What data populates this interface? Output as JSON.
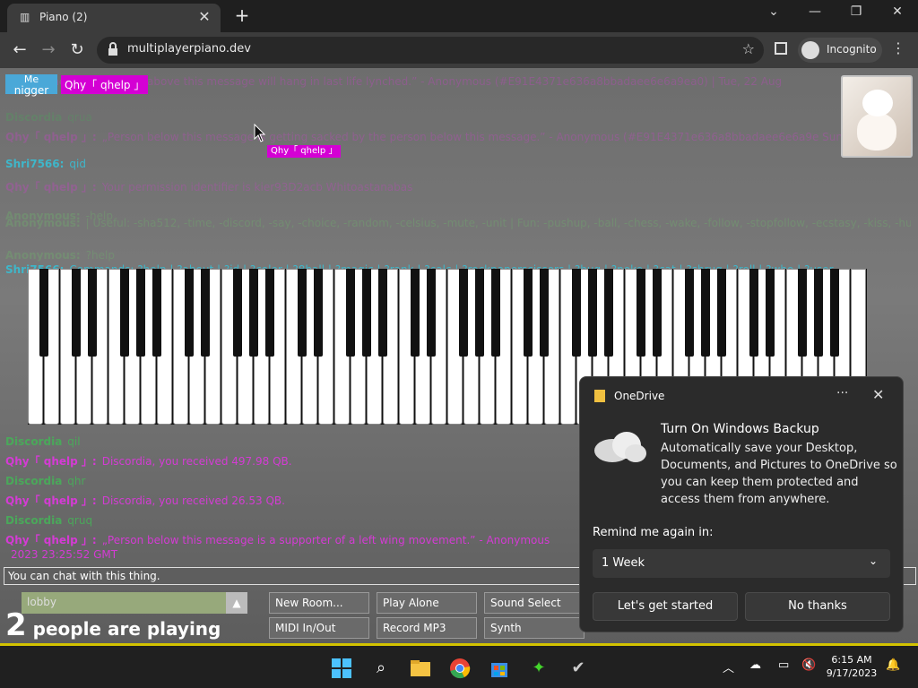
{
  "browser": {
    "tab_title": "Piano (2)",
    "url": "multiplayerpiano.dev",
    "incognito_label": "Incognito"
  },
  "overlay": {
    "badge_me": "Me",
    "badge_user": "nigger",
    "badge_qhy": "Qhy「 qhelp 」",
    "cursor_tag": "Qhy「 qhelp 」"
  },
  "chat": [
    {
      "name": "Qhy「 qhelp 」:",
      "text": "„Person above this message will hang in last life lynched.” - Anonymous (#E91E4371e636a8bbadaee6e6a9ea0) | Tue, 22 Aug",
      "color": "#d43bd4",
      "dim": true
    },
    {
      "name": "Discordia",
      "text": "qrua",
      "color": "#4aa85a",
      "dim": true
    },
    {
      "name": "Qhy「 qhelp 」:",
      "text": "„Person below this message is getting sacked by the person below this message.” - Anonymous (#E91E4371e636a8bbadaee6e6a9e Sun, 03 Sep 2023 14:35:41 GMT",
      "color": "#d43bd4",
      "dim": true
    },
    {
      "name": "Shri7566:",
      "text": "qid",
      "color": "#3fb6c9",
      "dim": false
    },
    {
      "name": "Qhy「 qhelp 」:",
      "text": "Your permission identifier is kier93D2acb Whitoastanabas",
      "color": "#d43bd4",
      "dim": true
    },
    {
      "name": "Anonymous:",
      "text": "-help",
      "color": "#6dbf6a",
      "dim": true
    },
    {
      "name": "Anonymous:",
      "text": "| Useful: -sha512, -time, -discord, -say, -choice, -random, -celsius, -mute, -unit | Fun: -pushup, -ball, -chess, -wake, -follow, -stopfollow, -ecstasy, -kiss, -hug, -cuddle, -8b, -dog, -aknkb, -poke, -lpm, -slap, -punch, -snipe, -wtf",
      "color": "#6dbf6a",
      "dim": true
    },
    {
      "name": "Anonymous:",
      "text": "?help",
      "color": "#6dbf6a",
      "dim": true
    },
    {
      "name": "Shri7566:",
      "text": "Commands: ?help | ?about | ?id | ?color | ?8ball | ?magic | ?rank | ?calc | ?rockpaperscissors | ?hug | ?poke | ?cat | ?shrug | ?roll | ?who | ?user",
      "color": "#3fb6c9",
      "dim": false
    },
    {
      "name": "Discordia",
      "text": "qil",
      "color": "#4aa85a",
      "dim": false
    },
    {
      "name": "Qhy「 qhelp 」:",
      "text": "Discordia, you received 497.98 QB.",
      "color": "#d43bd4",
      "dim": false
    },
    {
      "name": "Discordia",
      "text": "qhr",
      "color": "#4aa85a",
      "dim": false
    },
    {
      "name": "Qhy「 qhelp 」:",
      "text": "Discordia, you received 26.53 QB.",
      "color": "#d43bd4",
      "dim": false
    },
    {
      "name": "Discordia",
      "text": "qruq",
      "color": "#4aa85a",
      "dim": false
    },
    {
      "name": "Qhy「 qhelp 」:",
      "text": "„Person below this message is a supporter of a left wing movement.” - Anonymous",
      "color": "#d43bd4",
      "dim": false
    },
    {
      "name": "",
      "text": "2023 23:25:52 GMT",
      "color": "#d43bd4",
      "dim": false
    }
  ],
  "chat_input": {
    "placeholder": "You can chat with this thing."
  },
  "room": {
    "name": "lobby",
    "arrow": "▲",
    "count": "2",
    "count_label": "people are playing"
  },
  "buttons": {
    "new_room": "New Room...",
    "play_alone": "Play Alone",
    "sound_select": "Sound Select",
    "midi": "MIDI In/Out",
    "record": "Record MP3",
    "synth": "Synth"
  },
  "onedrive": {
    "app": "OneDrive",
    "more": "···",
    "close": "✕",
    "heading": "Turn On Windows Backup",
    "body": "Automatically save your Desktop, Documents, and Pictures to OneDrive so you can keep them protected and access them from anywhere.",
    "remind_label": "Remind me again in:",
    "remind_value": "1 Week",
    "primary": "Let's get started",
    "secondary": "No thanks"
  },
  "taskbar": {
    "time": "6:15 AM",
    "date": "9/17/2023"
  }
}
